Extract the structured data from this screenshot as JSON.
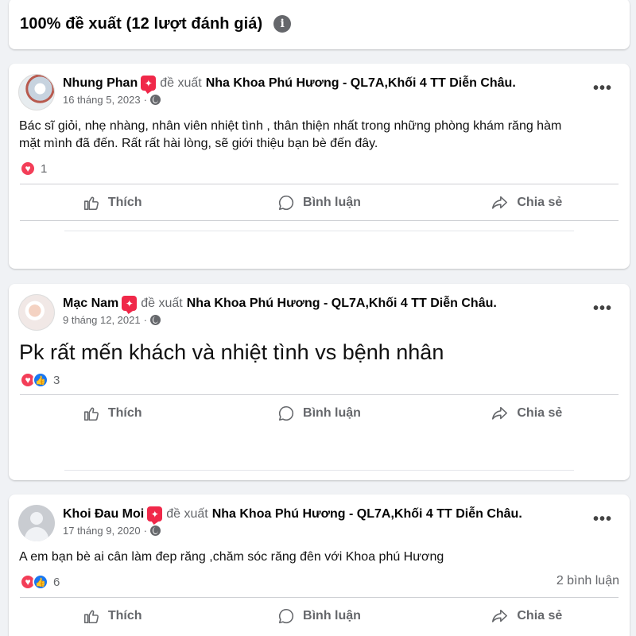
{
  "summary": {
    "title": "100% đề xuất (12 lượt đánh giá)",
    "info_icon": "info-icon"
  },
  "action_labels": {
    "like": "Thích",
    "comment": "Bình luận",
    "share": "Chia sẻ"
  },
  "posts": [
    {
      "author": "Nhung Phan",
      "verb": "đề xuất",
      "page": "Nha Khoa Phú Hương - QL7A,Khối 4 TT Diễn Châu.",
      "date": "16 tháng 5, 2023",
      "separator": "·",
      "text_line1": "Bác sĩ giỏi, nhẹ nhàng, nhân viên nhiệt tình , thân thiện nhất trong những phòng khám răng hàm",
      "text_line2": "mặt mình đã đến. Rất rất hài lòng, sẽ giới thiệu bạn bè đến đây.",
      "reaction_count": "1",
      "comment_count": ""
    },
    {
      "author": "Mạc Nam",
      "verb": "đề xuất",
      "page": "Nha Khoa Phú Hương - QL7A,Khối 4 TT Diễn Châu.",
      "date": "9 tháng 12, 2021",
      "separator": "·",
      "text_line1": "Pk rất mến khách và nhiệt tình vs bệnh nhân",
      "reaction_count": "3",
      "comment_count": ""
    },
    {
      "author": "Khoi Đau Moi",
      "verb": "đề xuất",
      "page": "Nha Khoa Phú Hương - QL7A,Khối 4 TT Diễn Châu.",
      "date": "17 tháng 9, 2020",
      "separator": "·",
      "text_line1": "A em bạn bè ai cân làm đep răng ,chăm sóc răng đên với Khoa phú Hương",
      "reaction_count": "6",
      "comment_count": "2 bình luận"
    }
  ],
  "colors": {
    "accent": "#1877f2",
    "love": "#f33e58",
    "recommend": "#f02849",
    "secondary_text": "#65676b",
    "background": "#f0f2f5"
  }
}
